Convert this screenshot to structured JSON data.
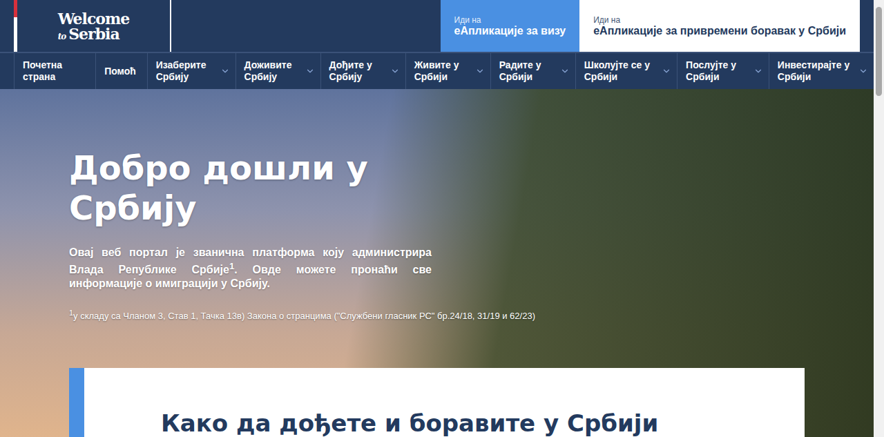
{
  "header": {
    "logo": {
      "line1": "Welcome",
      "line2": "to",
      "line3": "Serbia"
    },
    "buttons": [
      {
        "small": "Иди на",
        "label": "еАпликације за визу",
        "selected": true
      },
      {
        "small": "Иди на",
        "label": "еАпликације за привремени боравак у Србији",
        "selected": false
      }
    ]
  },
  "nav": {
    "items": [
      {
        "label": "Почетна страна",
        "dropdown": false
      },
      {
        "label": "Помоћ",
        "dropdown": false
      },
      {
        "label": "Изаберите Србију",
        "dropdown": true
      },
      {
        "label": "Доживите Србију",
        "dropdown": true
      },
      {
        "label": "Дођите у Србију",
        "dropdown": true
      },
      {
        "label": "Живите у Србији",
        "dropdown": true
      },
      {
        "label": "Радите у Србији",
        "dropdown": true
      },
      {
        "label": "Школујте се у Србији",
        "dropdown": true
      },
      {
        "label": "Послујте у Србији",
        "dropdown": true
      },
      {
        "label": "Инвестирајте у Србији",
        "dropdown": true
      }
    ]
  },
  "hero": {
    "title": "Добро дошли у Србију",
    "intro_before": "Овај веб портал је званична платформа коју администрира Влада Републике Србије",
    "intro_sup": "1",
    "intro_after": ". Овде можете пронаћи све информације о имиграцији у Србију.",
    "footnote_sup": "1",
    "footnote": "у складу са Чланом 3, Став 1, Тачка 13в) Закона о странцима (\"Службени гласник РС\" бр.24/18, 31/19 и 62/23)"
  },
  "card": {
    "heading": "Како да дођете и боравите у Србији"
  },
  "scrollbar": {
    "level": 0.21
  }
}
